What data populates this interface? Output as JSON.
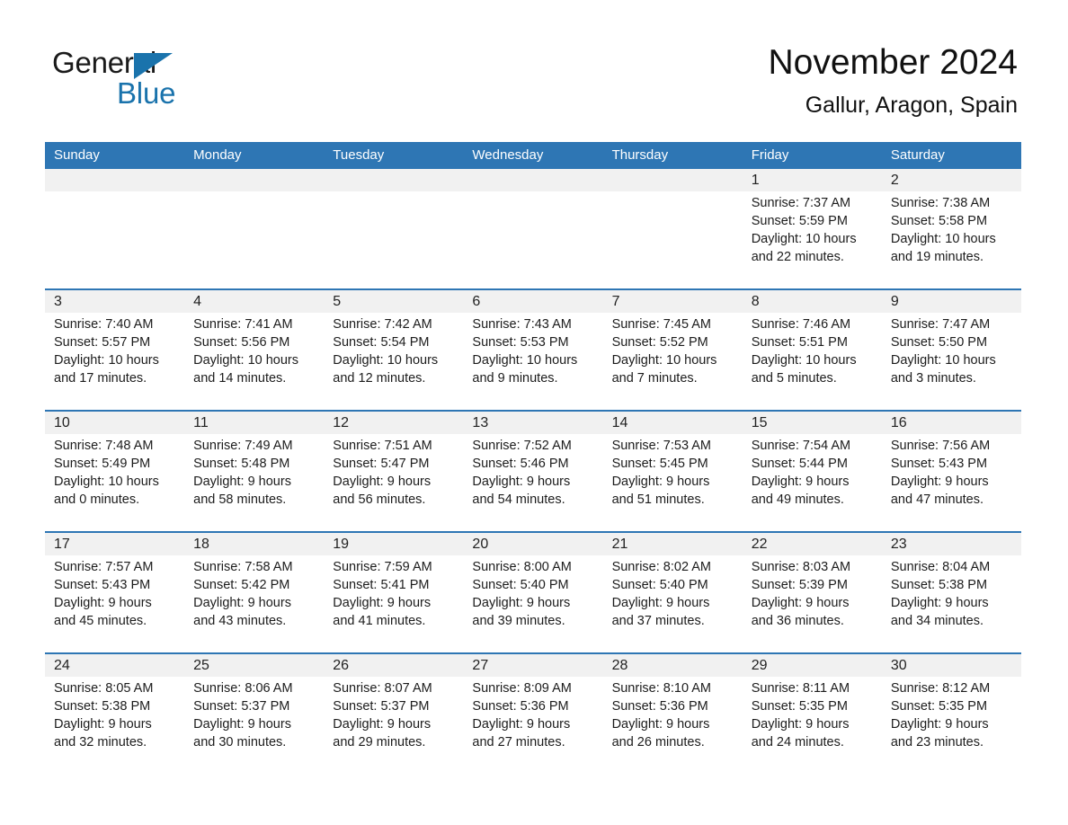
{
  "brand": {
    "name_part1": "General",
    "name_part2": "Blue",
    "accent_color": "#1a73ac"
  },
  "header": {
    "title": "November 2024",
    "location": "Gallur, Aragon, Spain"
  },
  "calendar": {
    "header_bg": "#2e76b4",
    "daynum_band_bg": "#f1f1f1",
    "weekday_headers": [
      "Sunday",
      "Monday",
      "Tuesday",
      "Wednesday",
      "Thursday",
      "Friday",
      "Saturday"
    ],
    "weeks": [
      [
        {
          "day": "",
          "sunrise": "",
          "sunset": "",
          "daylight_line1": "",
          "daylight_line2": ""
        },
        {
          "day": "",
          "sunrise": "",
          "sunset": "",
          "daylight_line1": "",
          "daylight_line2": ""
        },
        {
          "day": "",
          "sunrise": "",
          "sunset": "",
          "daylight_line1": "",
          "daylight_line2": ""
        },
        {
          "day": "",
          "sunrise": "",
          "sunset": "",
          "daylight_line1": "",
          "daylight_line2": ""
        },
        {
          "day": "",
          "sunrise": "",
          "sunset": "",
          "daylight_line1": "",
          "daylight_line2": ""
        },
        {
          "day": "1",
          "sunrise": "Sunrise: 7:37 AM",
          "sunset": "Sunset: 5:59 PM",
          "daylight_line1": "Daylight: 10 hours",
          "daylight_line2": "and 22 minutes."
        },
        {
          "day": "2",
          "sunrise": "Sunrise: 7:38 AM",
          "sunset": "Sunset: 5:58 PM",
          "daylight_line1": "Daylight: 10 hours",
          "daylight_line2": "and 19 minutes."
        }
      ],
      [
        {
          "day": "3",
          "sunrise": "Sunrise: 7:40 AM",
          "sunset": "Sunset: 5:57 PM",
          "daylight_line1": "Daylight: 10 hours",
          "daylight_line2": "and 17 minutes."
        },
        {
          "day": "4",
          "sunrise": "Sunrise: 7:41 AM",
          "sunset": "Sunset: 5:56 PM",
          "daylight_line1": "Daylight: 10 hours",
          "daylight_line2": "and 14 minutes."
        },
        {
          "day": "5",
          "sunrise": "Sunrise: 7:42 AM",
          "sunset": "Sunset: 5:54 PM",
          "daylight_line1": "Daylight: 10 hours",
          "daylight_line2": "and 12 minutes."
        },
        {
          "day": "6",
          "sunrise": "Sunrise: 7:43 AM",
          "sunset": "Sunset: 5:53 PM",
          "daylight_line1": "Daylight: 10 hours",
          "daylight_line2": "and 9 minutes."
        },
        {
          "day": "7",
          "sunrise": "Sunrise: 7:45 AM",
          "sunset": "Sunset: 5:52 PM",
          "daylight_line1": "Daylight: 10 hours",
          "daylight_line2": "and 7 minutes."
        },
        {
          "day": "8",
          "sunrise": "Sunrise: 7:46 AM",
          "sunset": "Sunset: 5:51 PM",
          "daylight_line1": "Daylight: 10 hours",
          "daylight_line2": "and 5 minutes."
        },
        {
          "day": "9",
          "sunrise": "Sunrise: 7:47 AM",
          "sunset": "Sunset: 5:50 PM",
          "daylight_line1": "Daylight: 10 hours",
          "daylight_line2": "and 3 minutes."
        }
      ],
      [
        {
          "day": "10",
          "sunrise": "Sunrise: 7:48 AM",
          "sunset": "Sunset: 5:49 PM",
          "daylight_line1": "Daylight: 10 hours",
          "daylight_line2": "and 0 minutes."
        },
        {
          "day": "11",
          "sunrise": "Sunrise: 7:49 AM",
          "sunset": "Sunset: 5:48 PM",
          "daylight_line1": "Daylight: 9 hours",
          "daylight_line2": "and 58 minutes."
        },
        {
          "day": "12",
          "sunrise": "Sunrise: 7:51 AM",
          "sunset": "Sunset: 5:47 PM",
          "daylight_line1": "Daylight: 9 hours",
          "daylight_line2": "and 56 minutes."
        },
        {
          "day": "13",
          "sunrise": "Sunrise: 7:52 AM",
          "sunset": "Sunset: 5:46 PM",
          "daylight_line1": "Daylight: 9 hours",
          "daylight_line2": "and 54 minutes."
        },
        {
          "day": "14",
          "sunrise": "Sunrise: 7:53 AM",
          "sunset": "Sunset: 5:45 PM",
          "daylight_line1": "Daylight: 9 hours",
          "daylight_line2": "and 51 minutes."
        },
        {
          "day": "15",
          "sunrise": "Sunrise: 7:54 AM",
          "sunset": "Sunset: 5:44 PM",
          "daylight_line1": "Daylight: 9 hours",
          "daylight_line2": "and 49 minutes."
        },
        {
          "day": "16",
          "sunrise": "Sunrise: 7:56 AM",
          "sunset": "Sunset: 5:43 PM",
          "daylight_line1": "Daylight: 9 hours",
          "daylight_line2": "and 47 minutes."
        }
      ],
      [
        {
          "day": "17",
          "sunrise": "Sunrise: 7:57 AM",
          "sunset": "Sunset: 5:43 PM",
          "daylight_line1": "Daylight: 9 hours",
          "daylight_line2": "and 45 minutes."
        },
        {
          "day": "18",
          "sunrise": "Sunrise: 7:58 AM",
          "sunset": "Sunset: 5:42 PM",
          "daylight_line1": "Daylight: 9 hours",
          "daylight_line2": "and 43 minutes."
        },
        {
          "day": "19",
          "sunrise": "Sunrise: 7:59 AM",
          "sunset": "Sunset: 5:41 PM",
          "daylight_line1": "Daylight: 9 hours",
          "daylight_line2": "and 41 minutes."
        },
        {
          "day": "20",
          "sunrise": "Sunrise: 8:00 AM",
          "sunset": "Sunset: 5:40 PM",
          "daylight_line1": "Daylight: 9 hours",
          "daylight_line2": "and 39 minutes."
        },
        {
          "day": "21",
          "sunrise": "Sunrise: 8:02 AM",
          "sunset": "Sunset: 5:40 PM",
          "daylight_line1": "Daylight: 9 hours",
          "daylight_line2": "and 37 minutes."
        },
        {
          "day": "22",
          "sunrise": "Sunrise: 8:03 AM",
          "sunset": "Sunset: 5:39 PM",
          "daylight_line1": "Daylight: 9 hours",
          "daylight_line2": "and 36 minutes."
        },
        {
          "day": "23",
          "sunrise": "Sunrise: 8:04 AM",
          "sunset": "Sunset: 5:38 PM",
          "daylight_line1": "Daylight: 9 hours",
          "daylight_line2": "and 34 minutes."
        }
      ],
      [
        {
          "day": "24",
          "sunrise": "Sunrise: 8:05 AM",
          "sunset": "Sunset: 5:38 PM",
          "daylight_line1": "Daylight: 9 hours",
          "daylight_line2": "and 32 minutes."
        },
        {
          "day": "25",
          "sunrise": "Sunrise: 8:06 AM",
          "sunset": "Sunset: 5:37 PM",
          "daylight_line1": "Daylight: 9 hours",
          "daylight_line2": "and 30 minutes."
        },
        {
          "day": "26",
          "sunrise": "Sunrise: 8:07 AM",
          "sunset": "Sunset: 5:37 PM",
          "daylight_line1": "Daylight: 9 hours",
          "daylight_line2": "and 29 minutes."
        },
        {
          "day": "27",
          "sunrise": "Sunrise: 8:09 AM",
          "sunset": "Sunset: 5:36 PM",
          "daylight_line1": "Daylight: 9 hours",
          "daylight_line2": "and 27 minutes."
        },
        {
          "day": "28",
          "sunrise": "Sunrise: 8:10 AM",
          "sunset": "Sunset: 5:36 PM",
          "daylight_line1": "Daylight: 9 hours",
          "daylight_line2": "and 26 minutes."
        },
        {
          "day": "29",
          "sunrise": "Sunrise: 8:11 AM",
          "sunset": "Sunset: 5:35 PM",
          "daylight_line1": "Daylight: 9 hours",
          "daylight_line2": "and 24 minutes."
        },
        {
          "day": "30",
          "sunrise": "Sunrise: 8:12 AM",
          "sunset": "Sunset: 5:35 PM",
          "daylight_line1": "Daylight: 9 hours",
          "daylight_line2": "and 23 minutes."
        }
      ]
    ]
  }
}
